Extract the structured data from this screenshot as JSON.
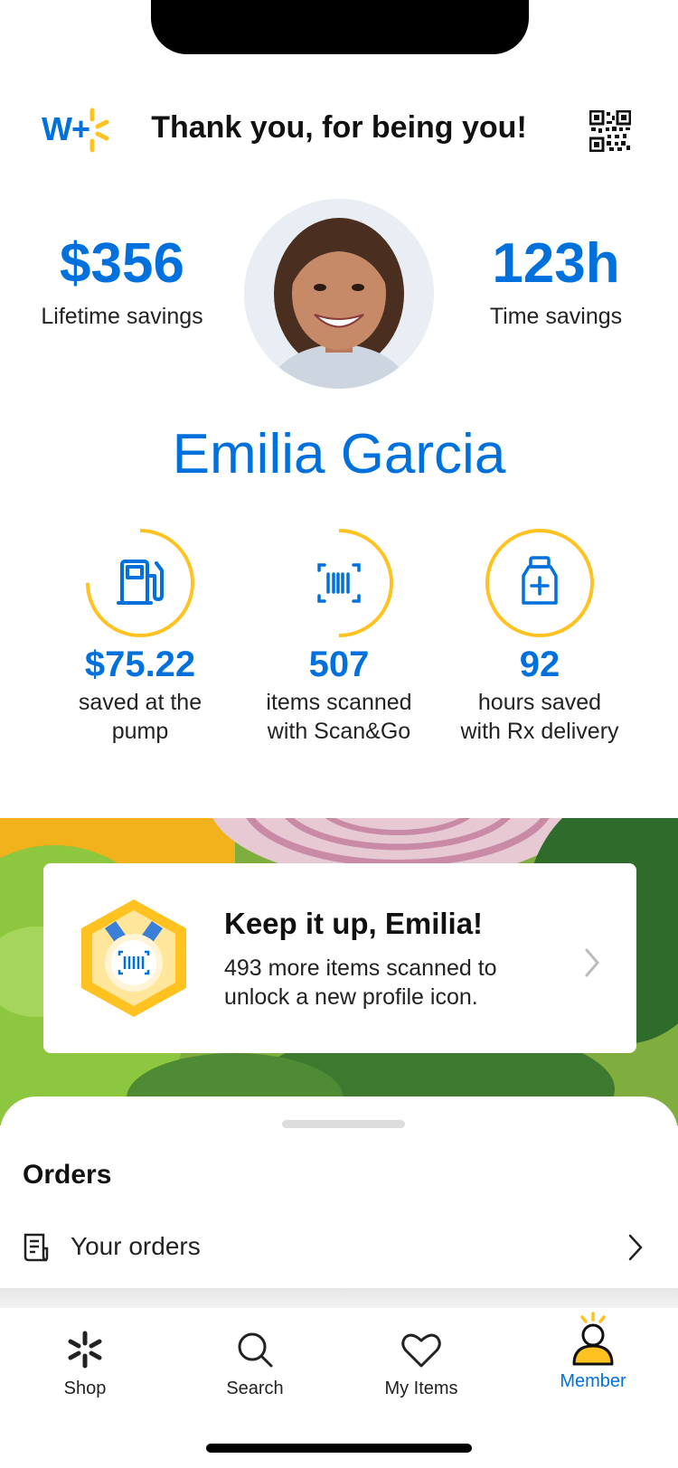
{
  "header": {
    "brand_text": "W+",
    "title": "Thank you, for being you!",
    "qr_icon": "qr-code-icon"
  },
  "stats": {
    "lifetime_value": "$356",
    "lifetime_label": "Lifetime savings",
    "time_value": "123h",
    "time_label": "Time savings"
  },
  "member": {
    "name": "Emilia Garcia"
  },
  "badges": [
    {
      "icon": "fuel-pump-icon",
      "value": "$75.22",
      "label_line1": "saved at the",
      "label_line2": "pump",
      "progress": 0.75
    },
    {
      "icon": "barcode-scan-icon",
      "value": "507",
      "label_line1": "items scanned",
      "label_line2": "with Scan&Go",
      "progress": 0.5
    },
    {
      "icon": "medicine-bottle-icon",
      "value": "92",
      "label_line1": "hours saved",
      "label_line2": "with Rx delivery",
      "progress": 1.0
    }
  ],
  "promo": {
    "title": "Keep it up, Emilia!",
    "text": "493 more items scanned to unlock a new profile icon."
  },
  "orders": {
    "heading": "Orders",
    "row_label": "Your orders"
  },
  "tabs": [
    {
      "label": "Shop",
      "icon": "spark-icon"
    },
    {
      "label": "Search",
      "icon": "search-icon"
    },
    {
      "label": "My Items",
      "icon": "heart-icon"
    },
    {
      "label": "Member",
      "icon": "member-icon",
      "active": true
    }
  ],
  "colors": {
    "brand_blue": "#0071dc",
    "spark_yellow": "#ffc220"
  }
}
